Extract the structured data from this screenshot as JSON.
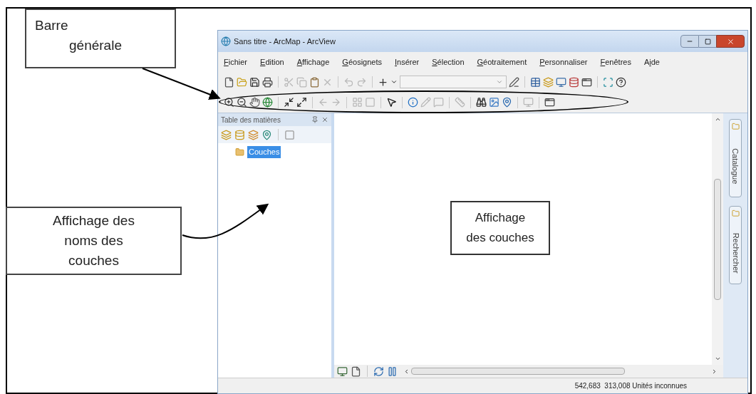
{
  "annotations": [
    {
      "kind": "callout",
      "lines": [
        "Barre",
        "générale"
      ]
    },
    {
      "kind": "callout",
      "lines": [
        "Affichage des",
        "noms des",
        "couches"
      ]
    }
  ],
  "window": {
    "title": "Sans titre - ArcMap - ArcView",
    "menu": [
      {
        "key": "F",
        "after": "ichier"
      },
      {
        "key": "E",
        "after": "dition"
      },
      {
        "key": "A",
        "after": "ffichage"
      },
      {
        "key": "G",
        "after": "éosignets"
      },
      {
        "key": "I",
        "after": "nsérer"
      },
      {
        "key": "S",
        "after": "élection"
      },
      {
        "key": "G",
        "after": "éotraitement"
      },
      {
        "key": "P",
        "after": "ersonnaliser"
      },
      {
        "key": "F",
        "after": "enêtres"
      },
      {
        "before": "A",
        "key": "i",
        "after": "de"
      }
    ],
    "toc": {
      "title": "Table des matières",
      "layers": [
        {
          "label": "Couches",
          "selected": true
        }
      ]
    },
    "map_label": [
      "Affichage",
      "des couches"
    ],
    "side_tabs": [
      {
        "label": "Catalogue"
      },
      {
        "label": "Rechercher"
      }
    ],
    "status_bar": "542,683  313,008 Unités inconnues"
  }
}
